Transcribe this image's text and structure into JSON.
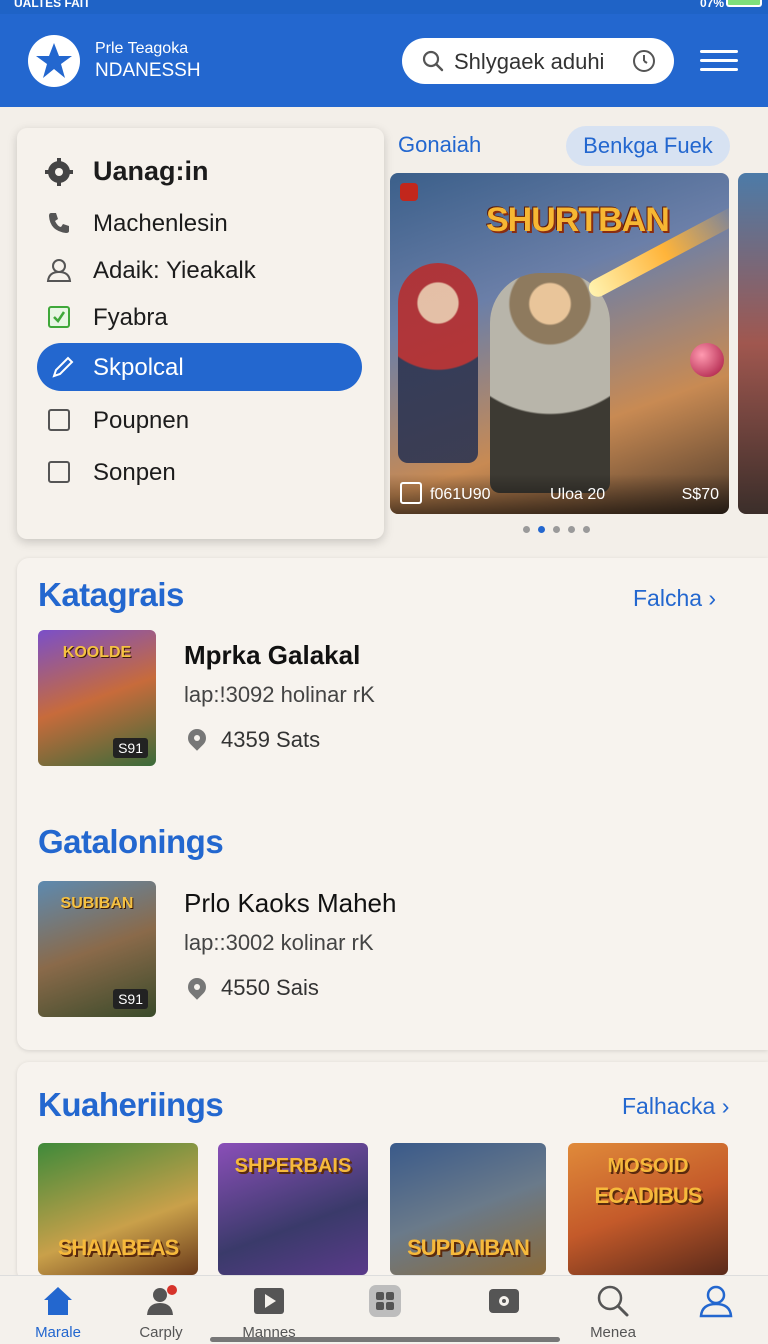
{
  "status_bar": {
    "left_text": "UALTES FAIT",
    "right_text": "07%"
  },
  "header": {
    "brand_line1": "Prle Teagoka",
    "brand_line2": "NDANESSH",
    "search_text": "Shlygaek aduhi"
  },
  "dropdown": {
    "items": [
      {
        "label": "Uanag:in",
        "icon": "gear-icon"
      },
      {
        "label": "Machenlesin",
        "icon": "phone-icon"
      },
      {
        "label": "Adaik: Yieakalk",
        "icon": "user-icon"
      },
      {
        "label": "Fyabra",
        "icon": "checkbox-checked-icon"
      },
      {
        "label": "Skpolcal",
        "icon": "pencil-icon"
      },
      {
        "label": "Poupnen",
        "icon": "checkbox-icon"
      },
      {
        "label": "Sonpen",
        "icon": "checkbox-icon"
      }
    ]
  },
  "tabs": {
    "first": "Gonaiah",
    "second": "Benkga Fuek"
  },
  "banner": {
    "title": "SHURTBAN",
    "left_caption": "f061U90",
    "mid_caption": "Uloa 20",
    "right_caption": "S$70"
  },
  "section1": {
    "title": "Katagrais",
    "more": "Falcha",
    "game": {
      "thumb_title": "KOOLDE",
      "price": "S91",
      "name": "Mprka Galakal",
      "sub": "lap:!3092 holinar rK",
      "location": "4359 Sats"
    }
  },
  "section2": {
    "title": "Gatalonings",
    "game": {
      "thumb_title": "SUBIBAN",
      "price": "S91",
      "name": "Prlo Kaoks Maheh",
      "sub": "lap::3002 kolinar rK",
      "location": "4550 Sais"
    }
  },
  "section3": {
    "title": "Kuaheriings",
    "more": "Falhacka",
    "tiles": [
      "SHAIABEAS",
      "SHPERBAIS",
      "SUPDAIBAN",
      "ECADIBUS"
    ],
    "tile_tops": [
      "",
      "",
      "",
      "MOSOID"
    ]
  },
  "bottom_nav": {
    "items": [
      {
        "label": "Marale",
        "icon": "home-icon"
      },
      {
        "label": "Carply",
        "icon": "user-icon"
      },
      {
        "label": "Mannes",
        "icon": "play-icon"
      },
      {
        "label": "",
        "icon": "grid-icon"
      },
      {
        "label": "",
        "icon": "camera-icon"
      },
      {
        "label": "Menea",
        "icon": "search-icon"
      },
      {
        "label": "",
        "icon": "profile-icon"
      }
    ]
  },
  "colors": {
    "accent": "#2367cf",
    "background": "#f3efe9"
  }
}
